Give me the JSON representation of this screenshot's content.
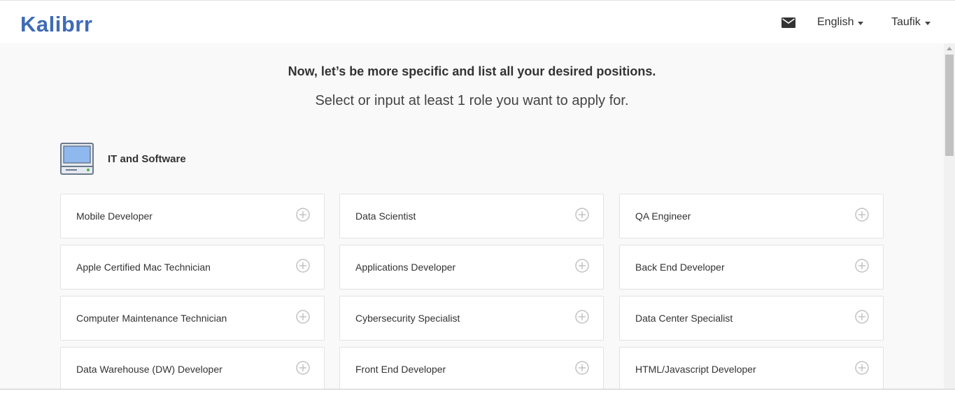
{
  "brand": {
    "logo_text": "Kalibrr",
    "accent_color": "#3f6bb5",
    "dot_color": "#3fb6c7"
  },
  "nav": {
    "mail_icon": "mail-icon",
    "language_label": "English",
    "user_label": "Taufik"
  },
  "main": {
    "heading": "Now, let’s be more specific and list all your desired positions.",
    "subheading": "Select or input at least 1 role you want to apply for."
  },
  "category": {
    "icon": "computer-icon",
    "title": "IT and Software",
    "roles": [
      {
        "label": "Mobile Developer"
      },
      {
        "label": "Data Scientist"
      },
      {
        "label": "QA Engineer"
      },
      {
        "label": "Apple Certified Mac Technician"
      },
      {
        "label": "Applications Developer"
      },
      {
        "label": "Back End Developer"
      },
      {
        "label": "Computer Maintenance Technician"
      },
      {
        "label": "Cybersecurity Specialist"
      },
      {
        "label": "Data Center Specialist"
      },
      {
        "label": "Data Warehouse (DW) Developer"
      },
      {
        "label": "Front End Developer"
      },
      {
        "label": "HTML/Javascript Developer"
      }
    ]
  }
}
